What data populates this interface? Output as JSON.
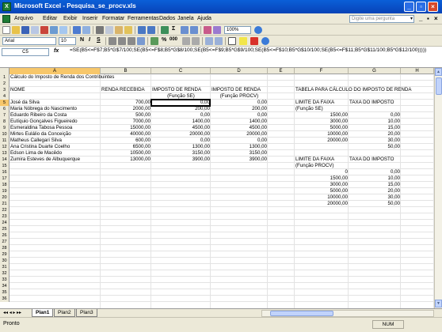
{
  "window": {
    "title": "Microsoft Excel - Pesquisa_se_procv.xls",
    "minimize": "_",
    "maximize": "▫",
    "close": "×"
  },
  "menu": {
    "items": [
      "Arquivo",
      "Editar",
      "Exibir",
      "Inserir",
      "Formatar",
      "Ferramentas",
      "Dados",
      "Janela",
      "Ajuda"
    ],
    "help_placeholder": "Digite uma pergunta",
    "help_arrow": "▾",
    "doc_minimize": "_",
    "doc_restore": "▪",
    "doc_close": "×"
  },
  "toolbar": {
    "zoom": "100%",
    "font_name": "Arial",
    "font_size": "10",
    "bold": "N",
    "italic": "I",
    "underline": "S",
    "percent": "%",
    "thousands": "000",
    "sum_symbol": "Σ"
  },
  "formula_bar": {
    "name_box": "C5",
    "fx": "fx",
    "formula": "=SE(B5<=F$7;B5*G$7/100;SE(B5<=F$8;B5*G$8/100;SE(B5<=F$9;B5*G$9/100;SE(B5<=F$10;B5*G$10/100;SE(B5<=F$11;B5*G$11/100;B5*G$12/100)))))"
  },
  "columns": [
    "A",
    "B",
    "C",
    "D",
    "E",
    "F",
    "G",
    "H"
  ],
  "active_column": "A",
  "active_row": 5,
  "row_numbers": [
    1,
    2,
    3,
    4,
    5,
    6,
    7,
    8,
    9,
    10,
    11,
    12,
    13,
    14,
    15,
    16,
    17,
    18,
    19,
    20,
    21,
    22,
    23,
    24,
    25,
    26,
    27,
    28,
    29,
    30,
    31,
    32,
    33,
    34,
    35,
    36
  ],
  "cells": {
    "A1": "Cálculo do Imposto de Renda dos Contribuintes",
    "A3": "NOME",
    "B3": "RENDA RECEBIDA",
    "C3": "IMPOSTO DE RENDA",
    "C4": "(Função SE)",
    "D3": "IMPOSTO DE RENDA",
    "D4": "(Função PROCV)",
    "F3": "TABELA PARA CÁLCULO DO IMPOSTO DE RENDA",
    "F5": "LIMITE DA FAIXA",
    "G5": "TAXA DO IMPOSTO",
    "F6": "(Função SE)",
    "A5": "José da Silva",
    "B5": "700,00",
    "C5": "0,00",
    "D5": "0,00",
    "A6": "Maria Nóbrega do Nascimento",
    "B6": "2000,00",
    "C6": "200,00",
    "D6": "200,00",
    "A7": "Eduardo Ribeiro da Costa",
    "B7": "500,00",
    "C7": "0,00",
    "D7": "0,00",
    "A8": "Eutíquio Gonçalves Figueiredo",
    "B8": "7000,00",
    "C8": "1400,00",
    "D8": "1400,00",
    "A9": "Esmeraldina Tabosa Pessoa",
    "B9": "15000,00",
    "C9": "4500,00",
    "D9": "4500,00",
    "A10": "Mirtes Eulálio da Conceição",
    "B10": "40000,00",
    "C10": "20000,00",
    "D10": "20000,00",
    "A11": "Matheus Callegari Silva",
    "B11": "600,00",
    "C11": "0,00",
    "D11": "0,00",
    "A12": "Ana Cristina Duarte Coelho",
    "B12": "6500,00",
    "C12": "1300,00",
    "D12": "1300,00",
    "A13": "Edson Lima de Macêdo",
    "B13": "10500,00",
    "C13": "3150,00",
    "D13": "3150,00",
    "A14": "Zumira Esteves de Albuquerque",
    "B14": "13000,00",
    "C14": "3900,00",
    "D14": "3900,00",
    "F7": "1500,00",
    "G7": "0,00",
    "F8": "3000,00",
    "G8": "10,00",
    "F9": "5000,00",
    "G9": "15,00",
    "F10": "10000,00",
    "G10": "20,00",
    "F11": "20000,00",
    "G11": "30,00",
    "G12": "50,00",
    "F14": "LIMITE DA FAIXA",
    "G14": "TAXA DO IMPOSTO",
    "F15": "(Função PROCV)",
    "F16": "0",
    "G16": "0,00",
    "F17": "1500,00",
    "G17": "10,00",
    "F18": "3000,00",
    "G18": "15,00",
    "F19": "5000,00",
    "G19": "20,00",
    "F20": "10000,00",
    "G20": "30,00",
    "F21": "20000,00",
    "G21": "50,00"
  },
  "sheet_tabs": [
    "Plan1",
    "Plan2",
    "Plan3"
  ],
  "active_sheet": "Plan1",
  "tab_nav": "◂◂ ◂ ▸ ▸▸",
  "status": {
    "left": "Pronto",
    "num": "NUM"
  }
}
